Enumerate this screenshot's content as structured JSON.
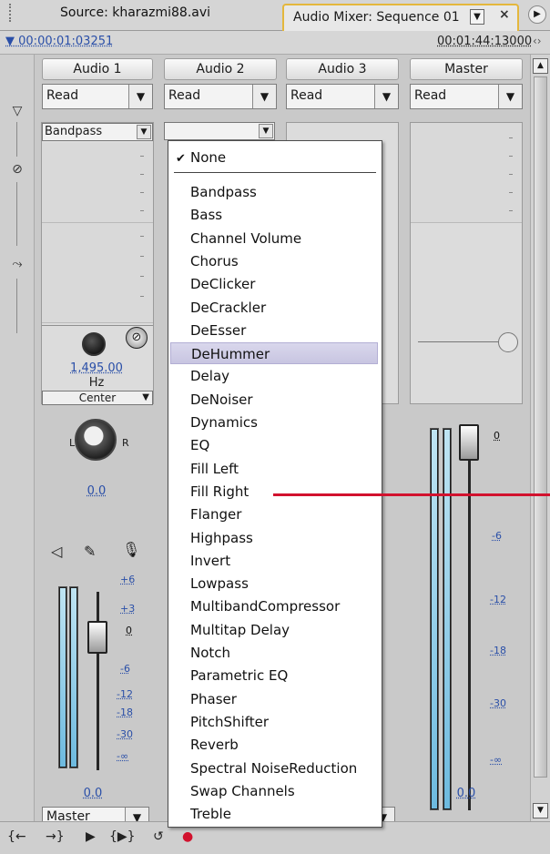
{
  "tabs": {
    "source_label": "Source: kharazmi88.avi",
    "mixer_label": "Audio Mixer: Sequence 01"
  },
  "timecode": {
    "current": "00:00:01:03251",
    "duration": "00:01:44:13000"
  },
  "channels": [
    {
      "name": "Audio 1",
      "automation": "Read",
      "effect": "Bandpass",
      "param_value": "1,495.00",
      "param_unit": "Hz",
      "param_select": "Center",
      "pan_value": "0.0",
      "volume_value": "0.0",
      "output": "Master"
    },
    {
      "name": "Audio 2",
      "automation": "Read"
    },
    {
      "name": "Audio 3",
      "automation": "Read"
    },
    {
      "name": "Master",
      "automation": "Read",
      "volume_value": "0.0"
    }
  ],
  "pan": {
    "left_label": "L",
    "right_label": "R"
  },
  "meter_scale_left": [
    "+6",
    "+3",
    "0",
    "-6",
    "-12",
    "-18",
    "-30",
    "-∞"
  ],
  "meter_scale_master": [
    "0",
    "-6",
    "-12",
    "-18",
    "-30",
    "-∞"
  ],
  "effect_menu": {
    "checked_item": "None",
    "highlighted_item": "DeHummer",
    "items": [
      "Bandpass",
      "Bass",
      "Channel Volume",
      "Chorus",
      "DeClicker",
      "DeCrackler",
      "DeEsser",
      "DeHummer",
      "Delay",
      "DeNoiser",
      "Dynamics",
      "EQ",
      "Fill Left",
      "Fill Right",
      "Flanger",
      "Highpass",
      "Invert",
      "Lowpass",
      "MultibandCompressor",
      "Multitap Delay",
      "Notch",
      "Parametric EQ",
      "Phaser",
      "PitchShifter",
      "Reverb",
      "Spectral NoiseReduction",
      "Swap Channels",
      "Treble"
    ]
  },
  "colors": {
    "accent_tab_border": "#e4b73c",
    "value_blue": "#2a4fa8",
    "highlight": "#c8c5e1",
    "annotation_red": "#d2122e",
    "meter_fill": "#6dbadf"
  },
  "icons": {
    "mute": "speaker-icon",
    "solo": "solo-icon",
    "record": "microphone-icon",
    "transport": [
      "go-to-in-icon",
      "go-to-out-icon",
      "play-icon",
      "play-in-out-icon",
      "loop-icon",
      "record-icon"
    ]
  }
}
